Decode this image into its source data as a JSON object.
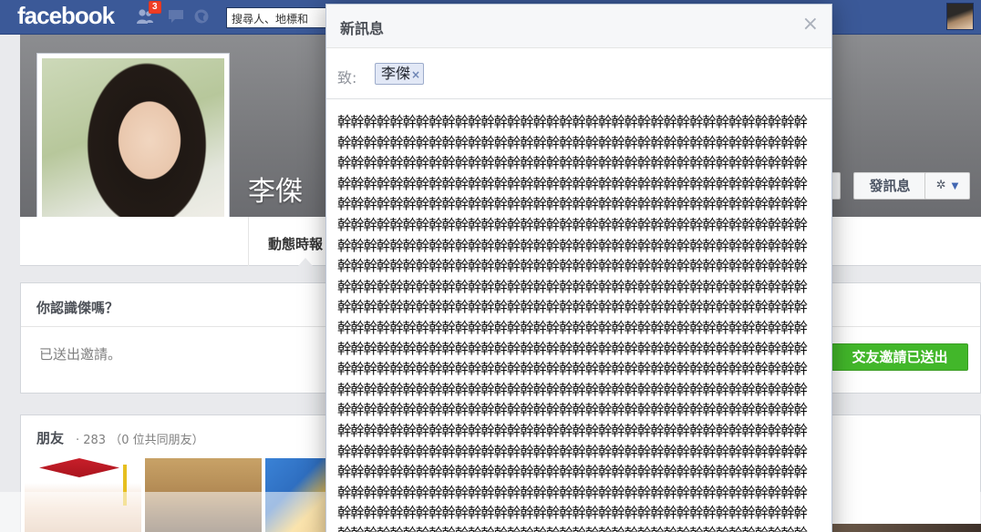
{
  "topbar": {
    "logo": "facebook",
    "friend_requests_count": "3",
    "search_placeholder": "搜尋人、地標和",
    "icons": [
      "friend-requests-icon",
      "messages-icon",
      "notifications-icon"
    ]
  },
  "profile": {
    "name": "李傑",
    "tab_timeline": "動態時報",
    "message_button": "發訊息",
    "gear_symbol": "✲",
    "caret_symbol": "▼"
  },
  "know_card": {
    "title": "你認識傑嗎？",
    "subtitle": "已送出邀請。",
    "friend_request_sent_button": "交友邀請已送出"
  },
  "friends_card": {
    "title": "朋友",
    "meta": "· 283 （0 位共同朋友）"
  },
  "modal": {
    "title": "新訊息",
    "close_symbol": "×",
    "to_label": "致:",
    "recipient": "李傑",
    "recipient_remove": "×",
    "body_text": "幹幹幹幹幹幹幹幹幹幹幹幹幹幹幹幹幹幹幹幹幹幹幹幹幹幹幹幹幹幹幹幹幹幹幹幹幹幹幹幹幹幹幹幹幹幹幹幹幹幹幹幹幹幹幹幹幹幹幹幹幹幹幹幹幹幹幹幹幹幹幹幹幹幹幹幹幹幹幹幹幹幹幹幹幹幹幹幹幹幹幹幹幹幹幹幹幹幹幹幹幹幹幹幹幹幹幹幹幹幹幹幹幹幹幹幹幹幹幹幹幹幹幹幹幹幹幹幹幹幹幹幹幹幹幹幹幹幹幹幹幹幹幹幹幹幹幹幹幹幹幹幹幹幹幹幹幹幹幹幹幹幹幹幹幹幹幹幹幹幹幹幹幹幹幹幹幹幹幹幹幹幹幹幹幹幹幹幹幹幹幹幹幹幹幹幹幹幹幹幹幹幹幹幹幹幹幹幹幹幹幹幹幹幹幹幹幹幹幹幹幹幹幹幹幹幹幹幹幹幹幹幹幹幹幹幹幹幹幹幹幹幹幹幹幹幹幹幹幹幹幹幹幹幹幹幹幹幹幹幹幹幹幹幹幹幹幹幹幹幹幹幹幹幹幹幹幹幹幹幹幹幹幹幹幹幹幹幹幹幹幹幹幹幹幹幹幹幹幹幹幹幹幹幹幹幹幹幹幹幹幹幹幹幹幹幹幹幹幹幹幹幹幹幹幹幹幹幹幹幹幹幹幹幹幹幹幹幹幹幹幹幹幹幹幹幹幹幹幹幹幹幹幹幹幹幹幹幹幹幹幹幹幹幹幹幹幹幹幹幹幹幹幹幹幹幹幹幹幹幹幹幹幹幹幹幹幹幹幹幹幹幹幹幹幹幹幹幹幹幹幹幹幹幹幹幹幹幹幹幹幹幹幹幹幹幹幹幹幹幹幹幹幹幹幹幹幹幹幹幹幹幹幹幹幹幹幹幹幹幹幹幹幹幹幹幹幹幹幹幹幹幹幹幹幹幹幹幹幹幹幹幹幹幹幹幹幹幹幹幹幹幹幹幹幹幹幹幹幹幹幹幹幹幹幹幹幹幹幹幹幹幹幹幹幹幹幹幹幹幹幹幹幹幹幹幹幹幹幹幹幹幹幹幹幹幹幹幹幹幹幹幹幹幹幹幹幹幹幹幹幹幹幹幹幹幹幹幹幹幹幹幹幹幹幹幹幹幹幹幹幹幹幹幹幹幹幹幹幹幹幹幹幹幹幹幹幹幹幹幹幹幹幹幹幹幹幹幹幹幹幹幹幹幹幹幹幹幹幹幹幹幹幹幹幹幹幹幹幹幹幹幹幹幹幹幹幹幹幹幹幹幹幹幹幹幹幹幹幹幹幹幹幹幹幹幹幹幹幹幹幹幹幹幹幹幹幹幹幹幹幹幹幹幹幹幹幹幹幹幹幹幹幹幹幹幹幹幹幹幹幹幹幹幹幹幹幹幹幹幹幹幹幹幹幹幹幹幹幹幹幹幹幹幹幹幹幹幹幹幹幹幹幹幹幹幹幹幹幹幹幹幹幹幹幹幹幹幹幹幹幹幹幹幹幹幹幹幹幹幹幹幹幹幹幹幹幹幹幹幹幹幹幹幹幹幹幹幹幹幹幹幹幹幹幹幹幹幹幹幹幹幹幹幹幹幹幹幹幹幹幹幹幹幹幹幹幹幹幹幹幹幹幹幹幹幹幹幹幹幹幹幹幹幹幹幹幹幹幹幹幹幹幹幹幹幹幹幹幹幹幹幹幹幹幹幹幹幹幹幹幹幹幹幹幹幹幹幹幹幹幹幹幹幹幹幹幹幹幹幹幹幹幹幹幹幹幹幹幹幹幹幹幹幹幹幹幹幹幹幹幹幹幹幹幹幹幹幹幹幹幹幹幹幹幹幹幹幹幹幹幹幹幹幹幹幹幹幹幹幹幹幹幹幹幹幹幹幹幹幹幹幹幹幹幹幹幹幹幹幹幹幹幹幹幹幹幹幹幹幹幹幹幹幹幹幹幹幹幹幹幹幹幹幹幹幹幹幹幹幹幹幹幹幹幹幹幹幹幹幹幹幹幹幹幹幹幹幹幹幹幹幹幹幹幹幹幹幹幹幹幹幹幹幹幹幹幹幹幹幹幹幹幹幹幹幹幹幹幹幹幹幹幹幹幹幹幹幹幹幹幹幹幹幹幹幹幹幹幹幹幹幹幹幹幹幹幹幹幹幹幹幹幹幹幹幹幹幹幹幹幹幹幹幹幹幹幹幹幹幹幹幹幹幹幹幹幹幹幹幹幹幹幹幹幹幹幹幹幹幹幹幹幹幹幹幹幹幹幹幹幹幹幹幹幹幹幹幹幹幹幹幹幹幹幹幹幹幹幹幹幹幹"
  },
  "colors": {
    "topbar": "#3b5998",
    "cover": "#7b7c80",
    "accent_green": "#42b72a",
    "token_bg": "#e2e8f6"
  }
}
